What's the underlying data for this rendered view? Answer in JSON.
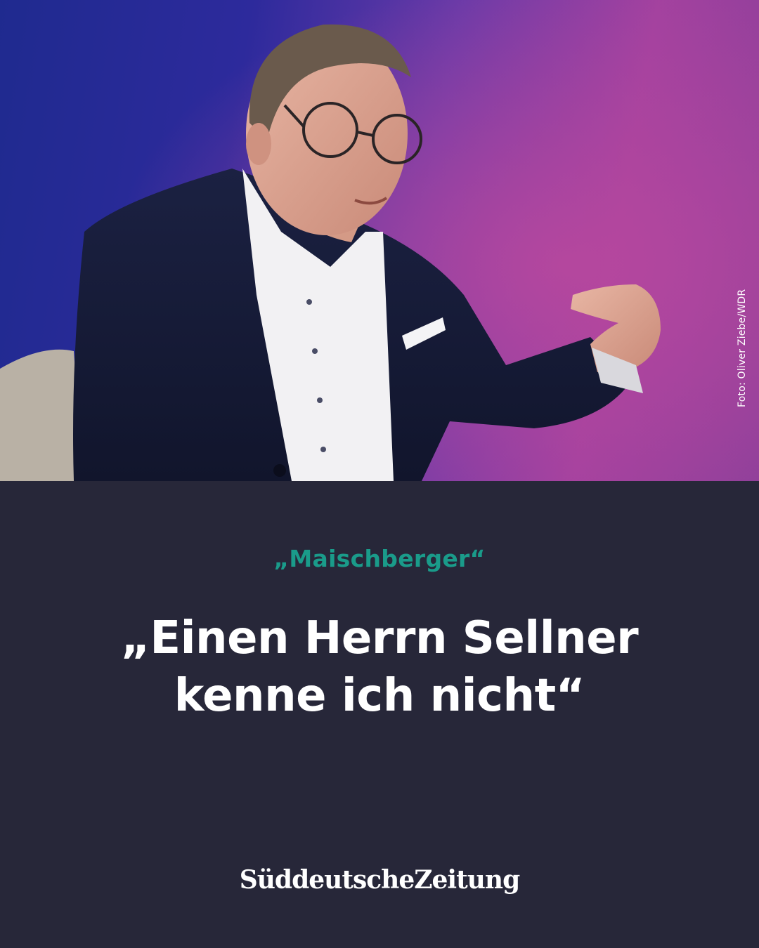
{
  "photo": {
    "credit": "Foto: Oliver Ziebe/WDR"
  },
  "article": {
    "kicker": "„Maischberger“",
    "headline_line1": "„Einen Herrn Sellner",
    "headline_line2": "kenne ich nicht“"
  },
  "brand": {
    "logo_text": "SüddeutscheZeitung"
  },
  "colors": {
    "background": "#272739",
    "kicker": "#1a9b8a",
    "headline": "#ffffff"
  }
}
